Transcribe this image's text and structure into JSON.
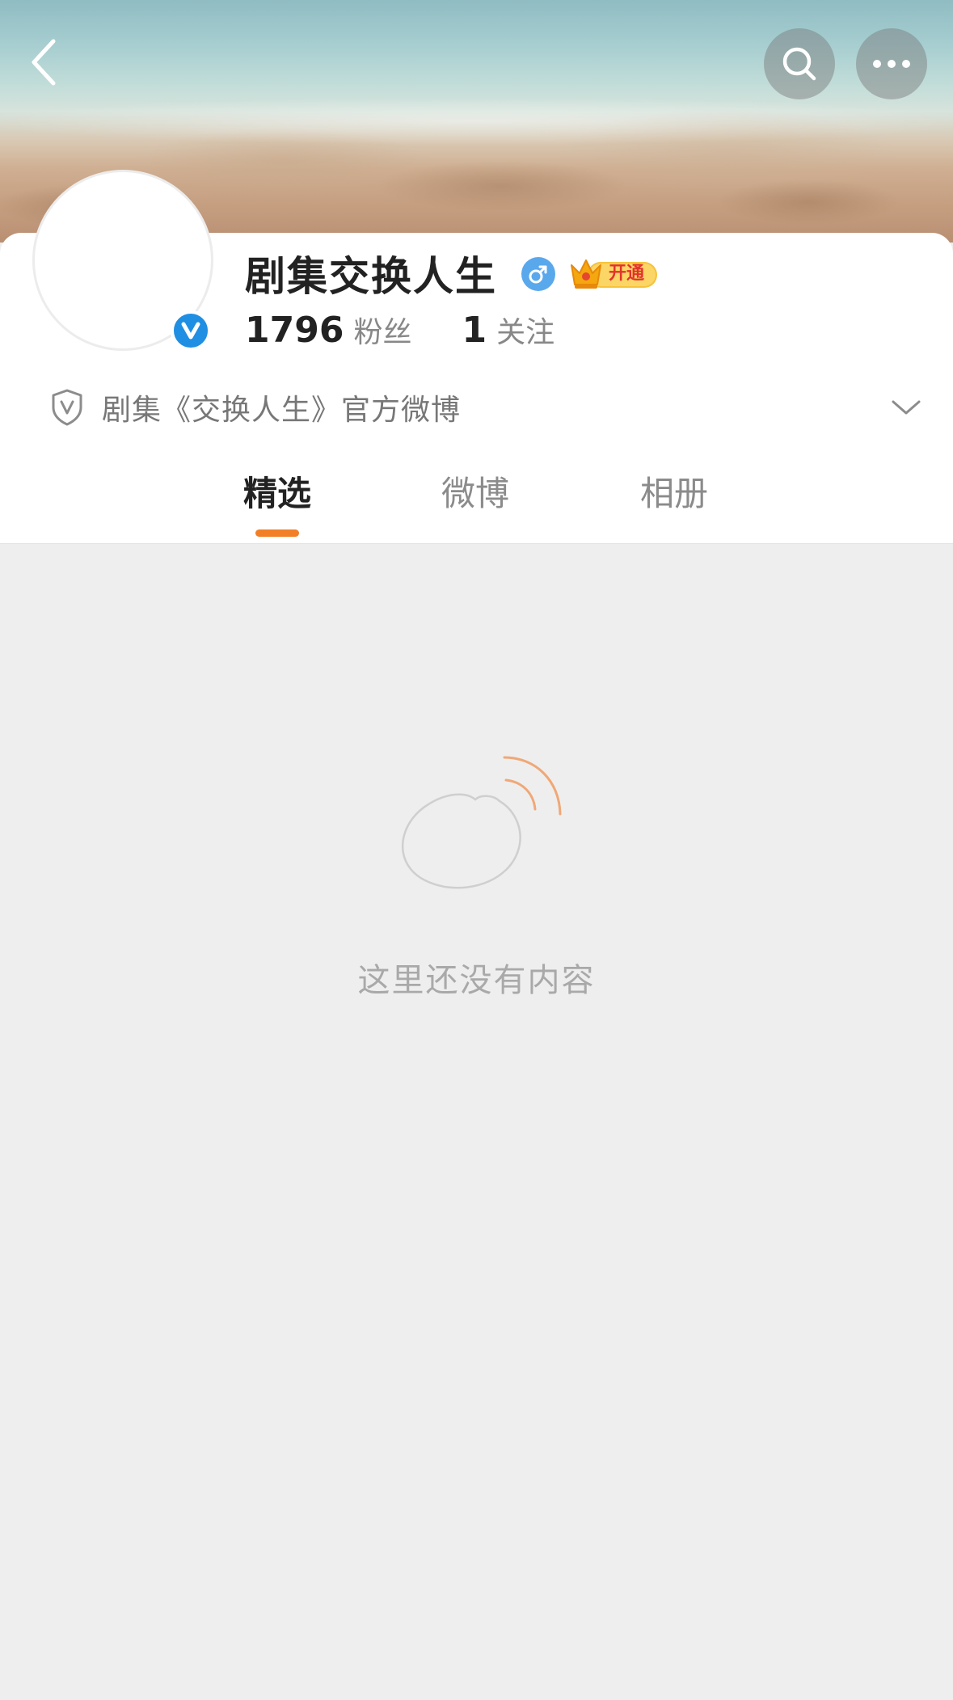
{
  "header": {
    "back_icon": "chevron-left-icon",
    "search_icon": "search-icon",
    "more_icon": "ellipsis-icon"
  },
  "profile": {
    "name": "剧集交换人生",
    "verified_icon": "verified-v-icon",
    "gender_icon": "male-icon",
    "vip_badge_label": "开通",
    "followers_count": "1796",
    "followers_label": "粉丝",
    "following_count": "1",
    "following_label": "关注",
    "description_icon": "shield-v-icon",
    "description": "剧集《交换人生》官方微博",
    "expand_icon": "chevron-down-icon"
  },
  "tabs": [
    {
      "label": "精选",
      "active": true
    },
    {
      "label": "微博",
      "active": false
    },
    {
      "label": "相册",
      "active": false
    }
  ],
  "empty_state": {
    "illustration_icon": "weibo-empty-icon",
    "message": "这里还没有内容"
  },
  "colors": {
    "accent": "#f27f26",
    "verified_blue": "#1f8fe3",
    "gender_blue": "#5aa8ec",
    "background": "#eeeeee"
  }
}
